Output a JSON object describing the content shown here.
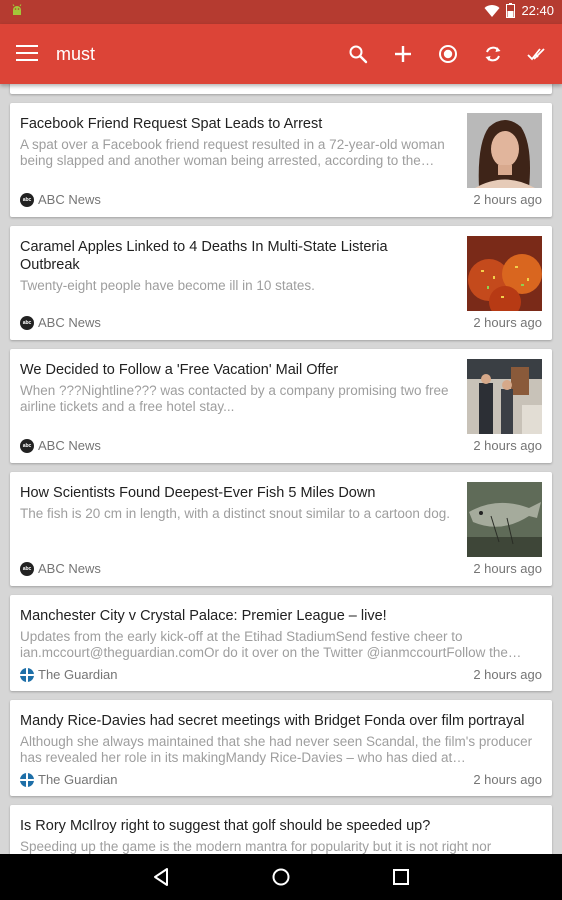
{
  "status_bar": {
    "time": "22:40"
  },
  "app_bar": {
    "title": "must",
    "actions": [
      "search-icon",
      "add-icon",
      "radio-icon",
      "refresh-icon",
      "mark-read-icon"
    ]
  },
  "colors": {
    "primary": "#dc4437",
    "status": "#b53b30"
  },
  "articles": [
    {
      "headline": "Facebook Friend Request Spat Leads to Arrest",
      "summary": "A spat over a Facebook friend request resulted in a 72-year-old woman being slapped and another woman being arrested, according to the…",
      "source": "ABC News",
      "time": "2 hours ago"
    },
    {
      "headline": "Caramel Apples Linked to 4 Deaths In Multi-State Listeria Outbreak",
      "summary": "Twenty-eight people have become ill in 10 states.",
      "source": "ABC News",
      "time": "2 hours ago"
    },
    {
      "headline": "We Decided to Follow a 'Free Vacation' Mail Offer",
      "summary": "When ???Nightline??? was contacted by a company promising two free airline tickets and a free hotel stay...",
      "source": "ABC News",
      "time": "2 hours ago"
    },
    {
      "headline": "How Scientists Found Deepest-Ever Fish 5 Miles Down",
      "summary": "The fish is 20 cm in length, with a distinct snout similar to a cartoon dog.",
      "source": "ABC News",
      "time": "2 hours ago"
    },
    {
      "headline": "Manchester City v Crystal Palace: Premier League – live!",
      "summary": "Updates from the early kick-off at the Etihad StadiumSend festive cheer to ian.mccourt@theguardian.comOr do it over on the Twitter @ianmccourtFollow the…",
      "source": "The Guardian",
      "time": "2 hours ago"
    },
    {
      "headline": "Mandy Rice-Davies had secret meetings with Bridget Fonda over film portrayal",
      "summary": "Although she always maintained that she had never seen Scandal, the film's producer has revealed her role in its makingMandy Rice-Davies – who has died at…",
      "source": "The Guardian",
      "time": "2 hours ago"
    },
    {
      "headline": "Is Rory McIlroy right to suggest that golf should be speeded up?",
      "summary": "Speeding up the game is the modern mantra for popularity but it is not right nor",
      "source": "",
      "time": ""
    }
  ]
}
